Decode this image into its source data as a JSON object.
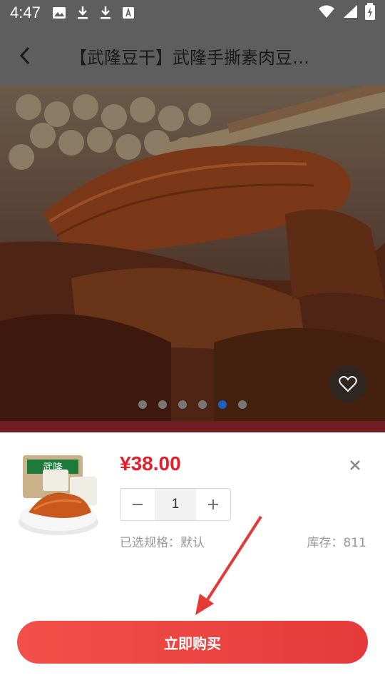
{
  "status_bar": {
    "time": "4:47"
  },
  "header": {
    "title": "【武隆豆干】武隆手撕素肉豆…"
  },
  "gallery": {
    "dot_count": 6,
    "active_index": 4
  },
  "sku": {
    "price": "¥38.00",
    "quantity": "1",
    "spec_text": "已选规格：默认",
    "stock_text": "库存：811"
  },
  "buy_button": {
    "label": "立即购买"
  },
  "colors": {
    "accent": "#e61e2a",
    "button": "#f2504a"
  }
}
